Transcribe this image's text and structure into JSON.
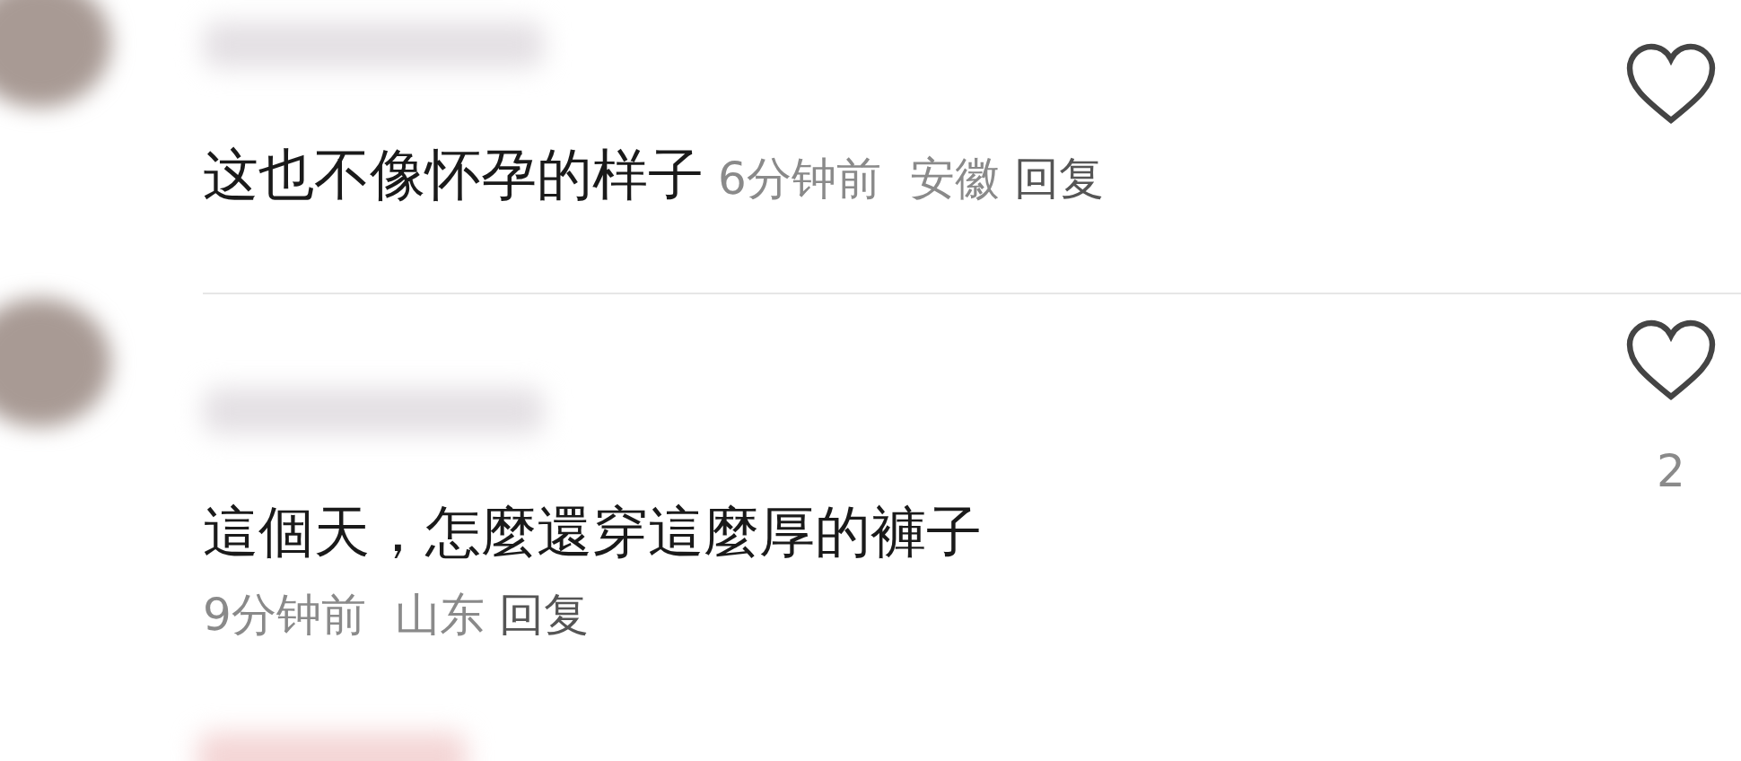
{
  "comments": [
    {
      "kind": "inline",
      "text": "这也不像怀孕的样子",
      "time": "6分钟前",
      "location": "安徽",
      "reply": "回复",
      "liked": false
    },
    {
      "kind": "stacked",
      "text": "這個天，怎麼還穿這麼厚的褲子",
      "time": "9分钟前",
      "location": "山东",
      "reply": "回复",
      "liked": false,
      "like_count": "2"
    }
  ]
}
